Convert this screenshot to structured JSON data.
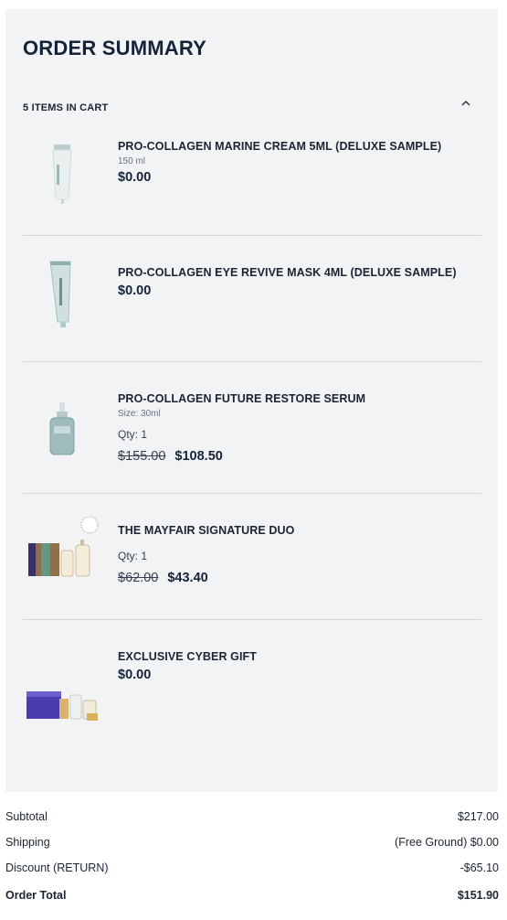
{
  "summary": {
    "title": "ORDER SUMMARY",
    "cart_count": "5 ITEMS IN CART"
  },
  "items": [
    {
      "name": "PRO-COLLAGEN MARINE CREAM 5ML (DELUXE SAMPLE)",
      "size": "150 ml",
      "price": "$0.00",
      "image": "marine-cream-tube-image"
    },
    {
      "name": "PRO-COLLAGEN EYE REVIVE MASK 4ML (DELUXE SAMPLE)",
      "price": "$0.00",
      "image": "eye-mask-tube-image"
    },
    {
      "name": "PRO-COLLAGEN FUTURE RESTORE SERUM",
      "size": "Size: 30ml",
      "qty": "Qty: 1",
      "old_price": "$155.00",
      "price": "$108.50",
      "image": "serum-bottle-image"
    },
    {
      "name": "THE MAYFAIR SIGNATURE DUO",
      "qty": "Qty: 1",
      "old_price": "$62.00",
      "price": "$43.40",
      "image": "gift-set-image"
    },
    {
      "name": "EXCLUSIVE CYBER GIFT",
      "price": "$0.00",
      "image": "gift-box-image"
    }
  ],
  "totals": {
    "subtotal_label": "Subtotal",
    "subtotal_value": "$217.00",
    "shipping_label": "Shipping",
    "shipping_value": "(Free Ground) $0.00",
    "discount_label": "Discount (RETURN)",
    "discount_value": "-$65.10",
    "total_label": "Order Total",
    "total_value": "$151.90"
  },
  "colors": {
    "panel_bg": "#f1f3f5",
    "title": "#152339",
    "divider": "#d2d6db"
  }
}
